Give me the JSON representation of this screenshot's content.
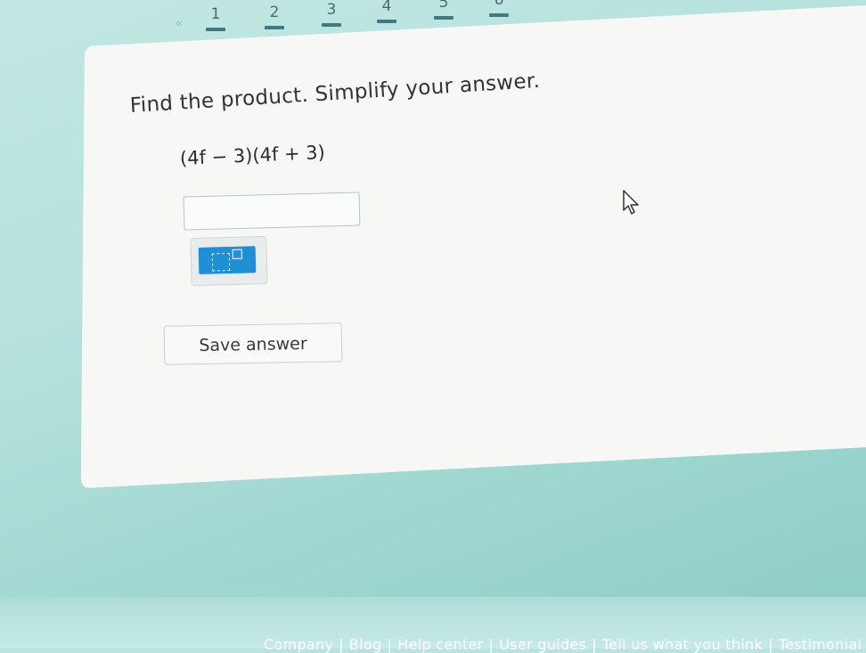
{
  "topbar": {
    "back_icon": "«",
    "steps": [
      "1",
      "2",
      "3",
      "4",
      "5",
      "6"
    ]
  },
  "question": {
    "prompt": "Find the product. Simplify your answer.",
    "expression": "(4f − 3)(4f + 3)"
  },
  "answer": {
    "value": ""
  },
  "tools": {
    "exponent_button": "exponent-template-icon"
  },
  "actions": {
    "save_label": "Save answer"
  },
  "footer": {
    "links": [
      "Company",
      "Blog",
      "Help center",
      "User guides",
      "Tell us what you think",
      "Testimonial"
    ]
  },
  "colors": {
    "accent_blue": "#1f8fd6",
    "card_bg": "#f7f8f6",
    "page_bg": "#b9e3df",
    "progress_dash": "#3e7a84"
  }
}
